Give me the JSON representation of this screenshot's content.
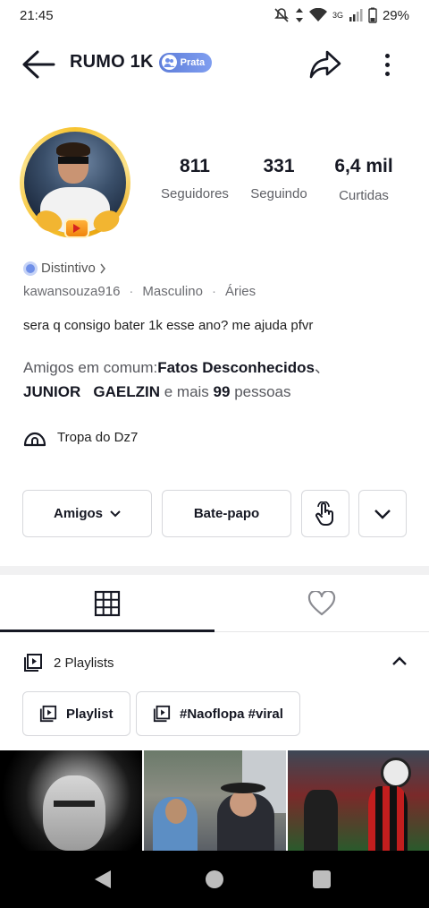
{
  "status": {
    "time": "21:45",
    "network": "3G",
    "battery": "29%"
  },
  "header": {
    "title": "RUMO 1K",
    "badge": "Prata"
  },
  "stats": [
    {
      "value": "811",
      "label": "Seguidores"
    },
    {
      "value": "331",
      "label": "Seguindo"
    },
    {
      "value": "6,4 mil",
      "label": "Curtidas"
    }
  ],
  "profile": {
    "distintivo": "Distintivo",
    "username": "kawansouza916",
    "gender": "Masculino",
    "sign": "Áries",
    "bio": "sera q consigo bater 1k esse ano? me ajuda pfvr"
  },
  "mutual": {
    "prefix": "Amigos em comum:",
    "friend1": "Fatos Desconhecidos",
    "sep": "、",
    "friend2": "JUNIOR",
    "friend3": "GAELZIN",
    "mid": " e mais ",
    "count": "99",
    "suffix": " pessoas"
  },
  "group": {
    "name": "Tropa do Dz7"
  },
  "actions": {
    "friends": "Amigos",
    "chat": "Bate-papo"
  },
  "playlists": {
    "header": "2 Playlists",
    "items": [
      "Playlist",
      "#Naoflopa #viral"
    ]
  },
  "icons": {
    "back": "back-arrow-icon",
    "share": "share-icon",
    "more": "more-vertical-icon",
    "grid": "grid-icon",
    "heart": "heart-icon"
  },
  "colors": {
    "badge": "#6f8fe8",
    "ring": "#f7c330",
    "text": "#161823"
  }
}
